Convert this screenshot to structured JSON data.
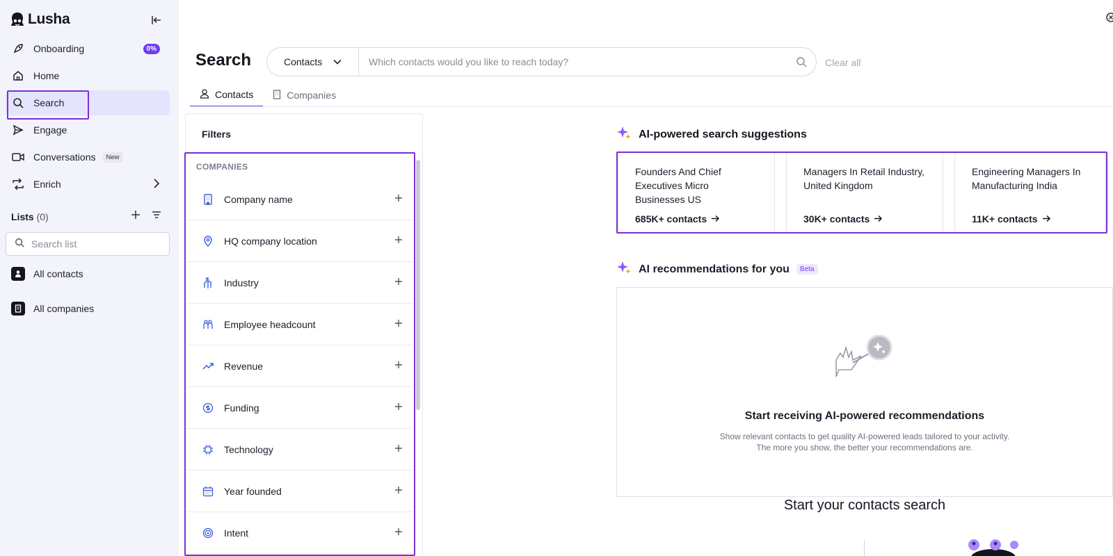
{
  "sidebar": {
    "logo": "Lusha",
    "nav": [
      {
        "label": "Onboarding",
        "badge": "0%",
        "icon": "rocket-icon"
      },
      {
        "label": "Home",
        "icon": "home-icon"
      },
      {
        "label": "Search",
        "icon": "search-icon"
      },
      {
        "label": "Engage",
        "icon": "send-icon"
      },
      {
        "label": "Conversations",
        "badge": "New",
        "icon": "video-icon"
      },
      {
        "label": "Enrich",
        "icon": "enrich-icon"
      }
    ],
    "lists": {
      "title": "Lists",
      "count": "(0)",
      "search_placeholder": "Search list"
    },
    "list_items": [
      "All contacts",
      "All companies"
    ]
  },
  "header": {
    "title": "Search",
    "type_select": "Contacts",
    "search_placeholder": "Which contacts would you like to reach today?",
    "clear_all": "Clear all",
    "tabs": [
      "Contacts",
      "Companies"
    ]
  },
  "filters": {
    "title": "Filters",
    "group": "COMPANIES",
    "items": [
      {
        "label": "Company name",
        "icon": "building-icon"
      },
      {
        "label": "HQ company location",
        "icon": "location-pin-icon"
      },
      {
        "label": "Industry",
        "icon": "industry-icon"
      },
      {
        "label": "Employee headcount",
        "icon": "people-icon"
      },
      {
        "label": "Revenue",
        "icon": "trend-up-icon"
      },
      {
        "label": "Funding",
        "icon": "dollar-icon"
      },
      {
        "label": "Technology",
        "icon": "chip-icon"
      },
      {
        "label": "Year founded",
        "icon": "calendar-icon"
      },
      {
        "label": "Intent",
        "icon": "target-icon"
      }
    ]
  },
  "ai_suggestions": {
    "title": "AI-powered search suggestions",
    "cards": [
      {
        "text": "Founders And Chief Executives Micro Businesses US",
        "count": "685K+ contacts"
      },
      {
        "text": "Managers In Retail Industry, United Kingdom",
        "count": "30K+ contacts"
      },
      {
        "text": "Engineering Managers In Manufacturing India",
        "count": "11K+ contacts"
      }
    ]
  },
  "recommendations": {
    "title": "AI recommendations for you",
    "badge": "Beta",
    "empty_title": "Start receiving AI-powered recommendations",
    "empty_line1": "Show relevant contacts to get quality AI-powered leads tailored to your activity.",
    "empty_line2": "The more you show, the better your recommendations are."
  },
  "start_search": "Start your contacts search",
  "colors": {
    "accent": "#7c3aed",
    "highlight": "#7a2fd6",
    "active_bg": "#e4e5fd",
    "icon_blue": "#3b5bdb"
  }
}
